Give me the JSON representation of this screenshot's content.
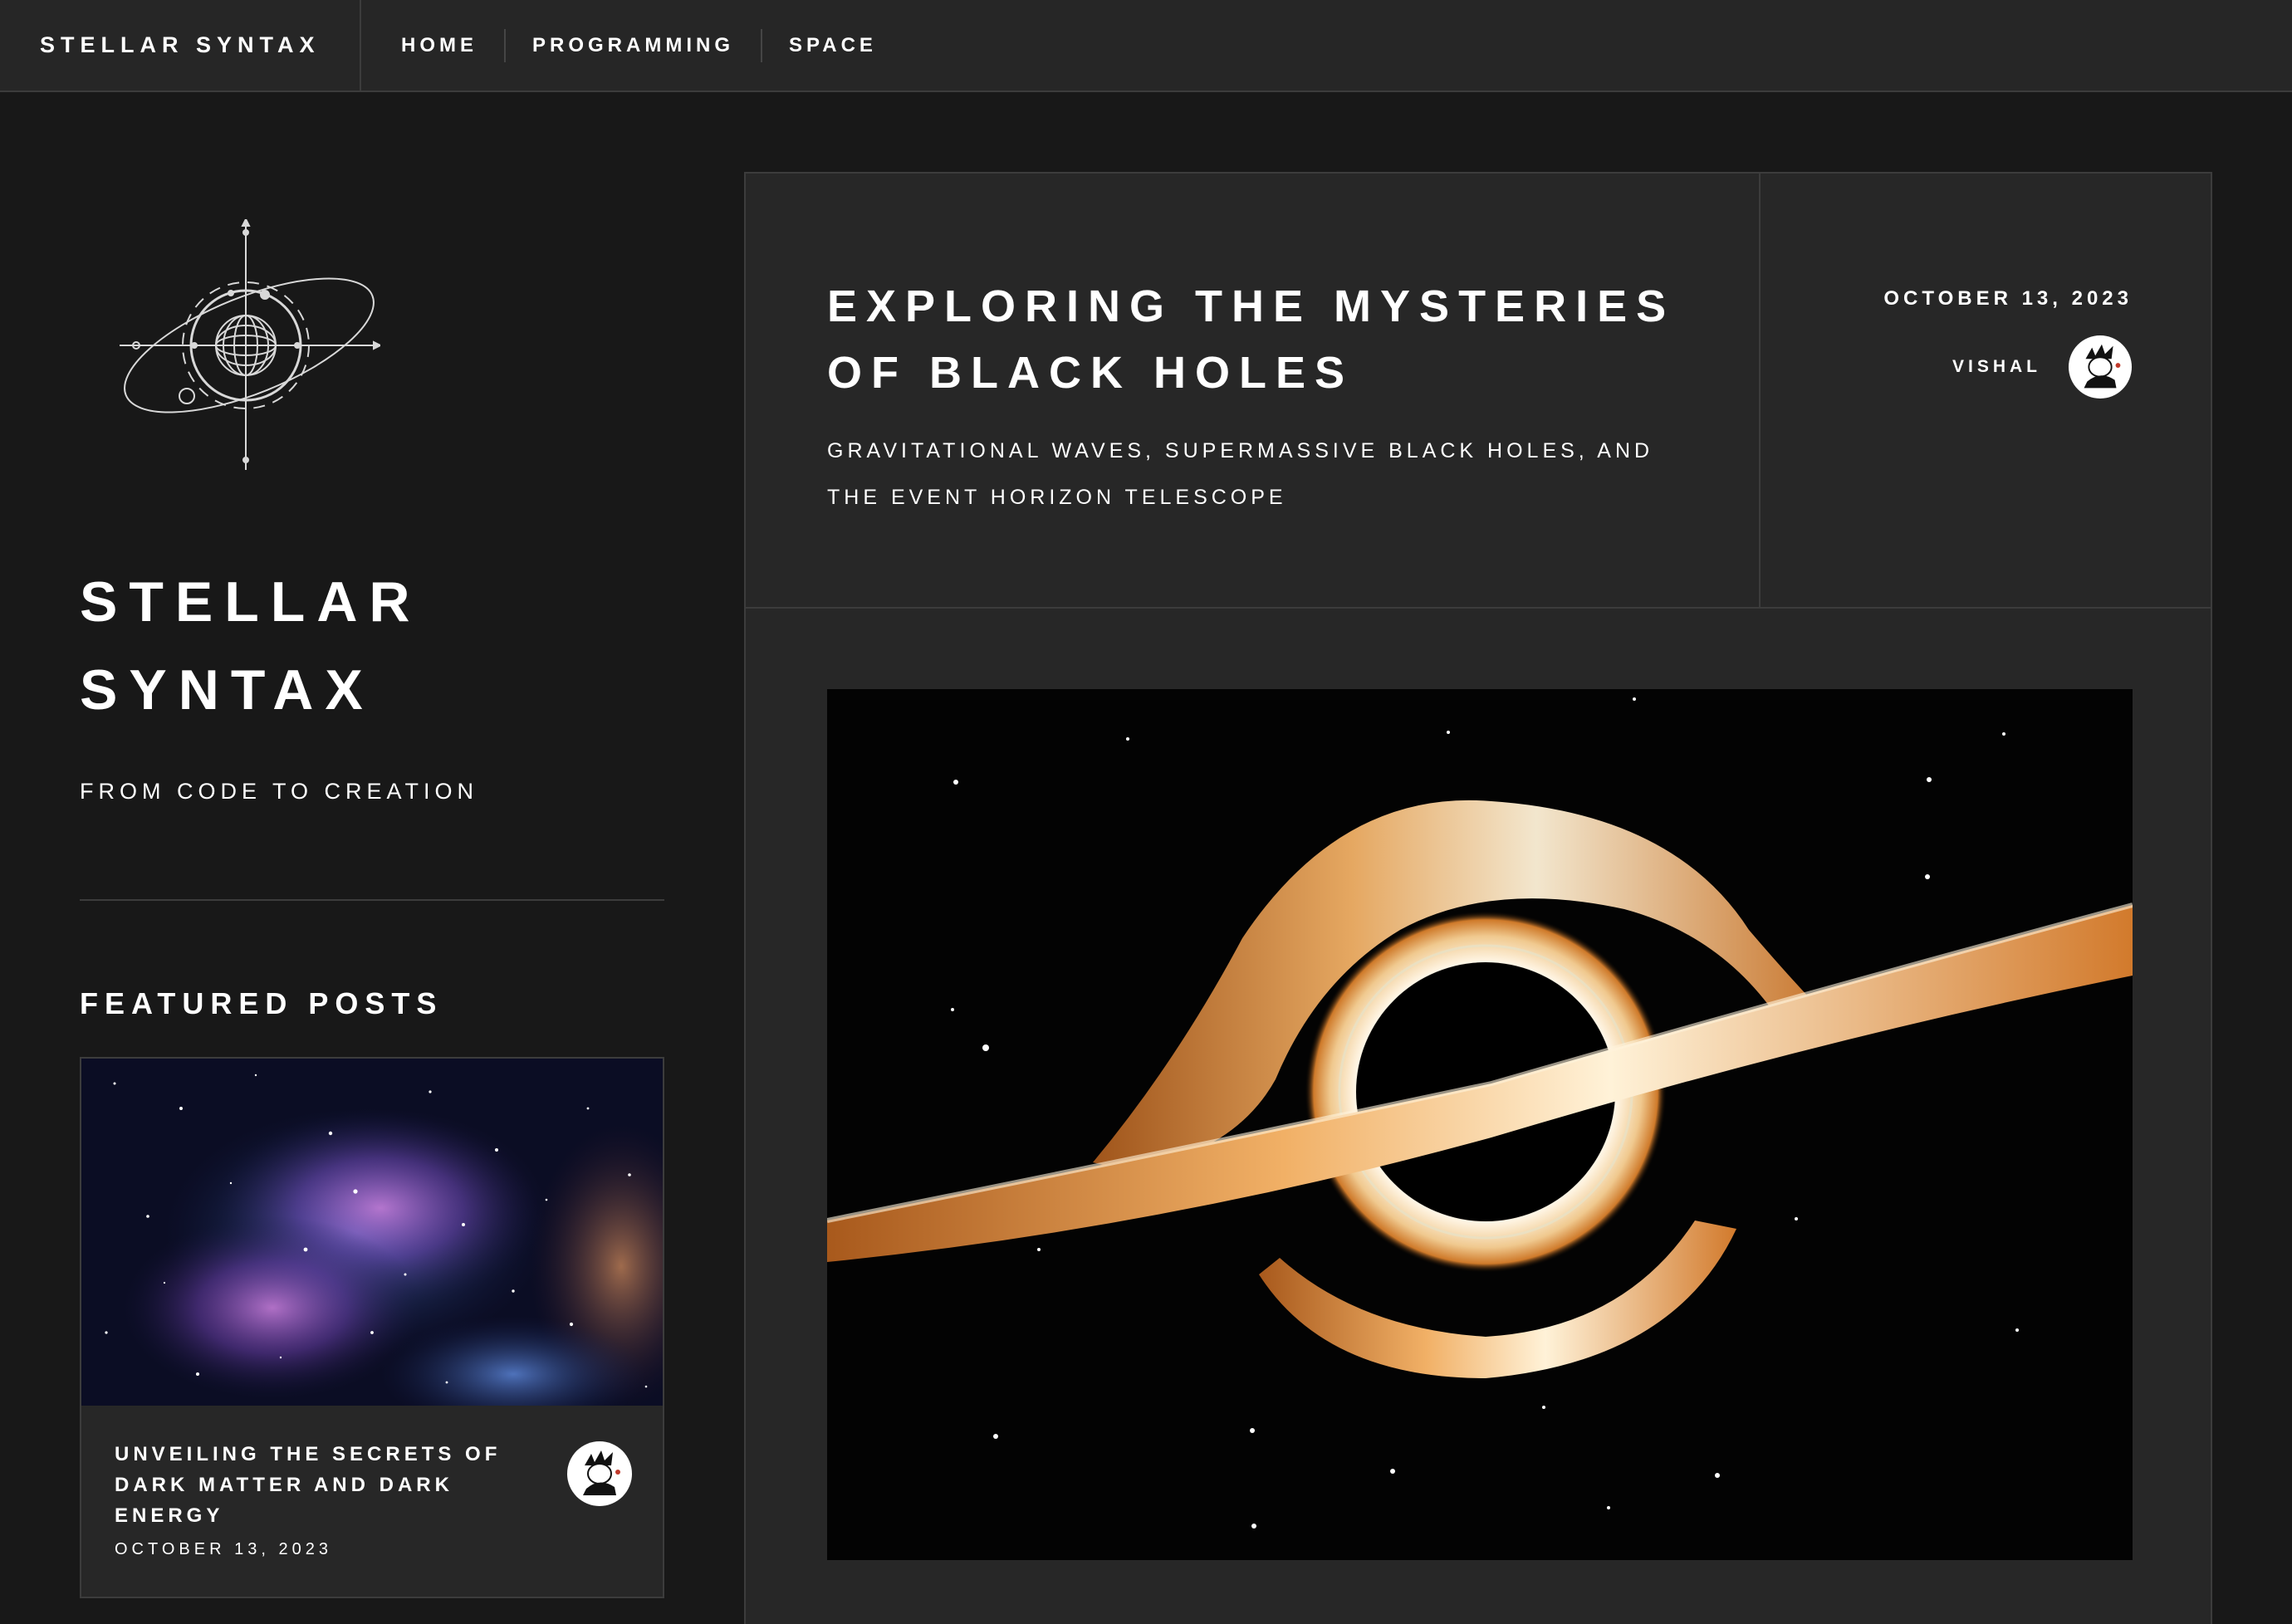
{
  "nav": {
    "brand": "STELLAR SYNTAX",
    "items": [
      {
        "label": "HOME"
      },
      {
        "label": "PROGRAMMING"
      },
      {
        "label": "SPACE"
      }
    ]
  },
  "sidebar": {
    "site_title": "STELLAR SYNTAX",
    "tagline": "FROM CODE TO CREATION",
    "featured_heading": "FEATURED POSTS",
    "featured_posts": [
      {
        "title": "UNVEILING THE SECRETS OF DARK MATTER AND DARK ENERGY",
        "date": "OCTOBER 13, 2023"
      }
    ]
  },
  "post": {
    "title": "EXPLORING THE MYSTERIES OF BLACK HOLES",
    "subtitle": "GRAVITATIONAL WAVES, SUPERMASSIVE BLACK HOLES, AND THE EVENT HORIZON TELESCOPE",
    "date": "OCTOBER 13, 2023",
    "author": "VISHAL"
  },
  "colors": {
    "page_background": "#181818",
    "panel_background": "#272727",
    "border": "#3c3c3c",
    "text": "#ffffff",
    "accretion_disk": "#e8a050"
  }
}
